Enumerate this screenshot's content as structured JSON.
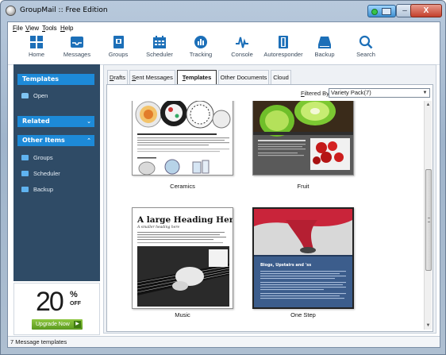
{
  "window": {
    "title": "GroupMail :: Free Edition",
    "controls": {
      "minimize": "–",
      "maximize": "□",
      "close": "X"
    }
  },
  "menu": [
    {
      "label": "File",
      "accel": "F",
      "rest": "ile"
    },
    {
      "label": "View",
      "accel": "V",
      "rest": "iew"
    },
    {
      "label": "Tools",
      "accel": "T",
      "rest": "ools"
    },
    {
      "label": "Help",
      "accel": "H",
      "rest": "elp"
    }
  ],
  "toolbar": [
    {
      "label": "Home",
      "icon": "home-grid-icon"
    },
    {
      "label": "Messages",
      "icon": "inbox-tray-icon"
    },
    {
      "label": "Groups",
      "icon": "groups-book-icon"
    },
    {
      "label": "Scheduler",
      "icon": "calendar-icon"
    },
    {
      "label": "Tracking",
      "icon": "tracking-pie-icon"
    },
    {
      "label": "Console",
      "icon": "console-pulse-icon"
    },
    {
      "label": "Autoresponder",
      "icon": "autoresponder-icon"
    },
    {
      "label": "Backup",
      "icon": "backup-drive-icon"
    },
    {
      "label": "Search",
      "icon": "search-icon"
    }
  ],
  "sidebar": {
    "templates_header": "Templates",
    "open_label": "Open",
    "related_header": "Related",
    "other_header": "Other Items",
    "other_items": [
      "Groups",
      "Scheduler",
      "Backup"
    ],
    "collapse_glyph": "»",
    "expand_glyph": "«"
  },
  "promo": {
    "number": "20",
    "percent": "%",
    "off": "OFF",
    "button": "Upgrade Now",
    "arrow": "▶"
  },
  "tabs": [
    {
      "accel": "D",
      "rest": "rafts"
    },
    {
      "accel": "S",
      "rest": "ent Messages"
    },
    {
      "accel": "T",
      "rest": "emplates"
    },
    {
      "accel": "",
      "rest": "Other Documents"
    },
    {
      "accel": "",
      "rest": "Cloud"
    }
  ],
  "active_tab_index": 2,
  "filter": {
    "label_accel": "F",
    "label_rest": "iltered By:",
    "value": "Variety Pack(7)",
    "dropdown_glyph": "▼"
  },
  "templates": [
    {
      "caption": "Ceramics"
    },
    {
      "caption": "Fruit"
    },
    {
      "caption": "Music",
      "thumb_heading": "A large Heading Here",
      "thumb_sub": "A smaller heading here"
    },
    {
      "caption": "One Step",
      "thumb_heading": "Blogs, Upstairs and 'ss"
    }
  ],
  "scrollbar": {
    "up": "▲",
    "down": "▼"
  },
  "status": {
    "text": "7 Message templates"
  },
  "colors": {
    "sidebar_bg": "#2f4b66",
    "sidebar_header": "#1d8ad8",
    "toolbar_icon": "#1c6fb8",
    "upgrade_green": "#6fae2b"
  }
}
